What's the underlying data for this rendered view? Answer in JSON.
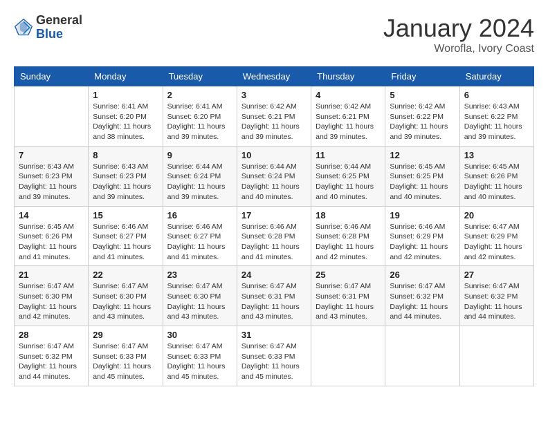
{
  "header": {
    "logo_general": "General",
    "logo_blue": "Blue",
    "month_year": "January 2024",
    "location": "Worofla, Ivory Coast"
  },
  "weekdays": [
    "Sunday",
    "Monday",
    "Tuesday",
    "Wednesday",
    "Thursday",
    "Friday",
    "Saturday"
  ],
  "weeks": [
    [
      {
        "day": "",
        "sunrise": "",
        "sunset": "",
        "daylight": ""
      },
      {
        "day": "1",
        "sunrise": "Sunrise: 6:41 AM",
        "sunset": "Sunset: 6:20 PM",
        "daylight": "Daylight: 11 hours and 38 minutes."
      },
      {
        "day": "2",
        "sunrise": "Sunrise: 6:41 AM",
        "sunset": "Sunset: 6:20 PM",
        "daylight": "Daylight: 11 hours and 39 minutes."
      },
      {
        "day": "3",
        "sunrise": "Sunrise: 6:42 AM",
        "sunset": "Sunset: 6:21 PM",
        "daylight": "Daylight: 11 hours and 39 minutes."
      },
      {
        "day": "4",
        "sunrise": "Sunrise: 6:42 AM",
        "sunset": "Sunset: 6:21 PM",
        "daylight": "Daylight: 11 hours and 39 minutes."
      },
      {
        "day": "5",
        "sunrise": "Sunrise: 6:42 AM",
        "sunset": "Sunset: 6:22 PM",
        "daylight": "Daylight: 11 hours and 39 minutes."
      },
      {
        "day": "6",
        "sunrise": "Sunrise: 6:43 AM",
        "sunset": "Sunset: 6:22 PM",
        "daylight": "Daylight: 11 hours and 39 minutes."
      }
    ],
    [
      {
        "day": "7",
        "sunrise": "Sunrise: 6:43 AM",
        "sunset": "Sunset: 6:23 PM",
        "daylight": "Daylight: 11 hours and 39 minutes."
      },
      {
        "day": "8",
        "sunrise": "Sunrise: 6:43 AM",
        "sunset": "Sunset: 6:23 PM",
        "daylight": "Daylight: 11 hours and 39 minutes."
      },
      {
        "day": "9",
        "sunrise": "Sunrise: 6:44 AM",
        "sunset": "Sunset: 6:24 PM",
        "daylight": "Daylight: 11 hours and 39 minutes."
      },
      {
        "day": "10",
        "sunrise": "Sunrise: 6:44 AM",
        "sunset": "Sunset: 6:24 PM",
        "daylight": "Daylight: 11 hours and 40 minutes."
      },
      {
        "day": "11",
        "sunrise": "Sunrise: 6:44 AM",
        "sunset": "Sunset: 6:25 PM",
        "daylight": "Daylight: 11 hours and 40 minutes."
      },
      {
        "day": "12",
        "sunrise": "Sunrise: 6:45 AM",
        "sunset": "Sunset: 6:25 PM",
        "daylight": "Daylight: 11 hours and 40 minutes."
      },
      {
        "day": "13",
        "sunrise": "Sunrise: 6:45 AM",
        "sunset": "Sunset: 6:26 PM",
        "daylight": "Daylight: 11 hours and 40 minutes."
      }
    ],
    [
      {
        "day": "14",
        "sunrise": "Sunrise: 6:45 AM",
        "sunset": "Sunset: 6:26 PM",
        "daylight": "Daylight: 11 hours and 41 minutes."
      },
      {
        "day": "15",
        "sunrise": "Sunrise: 6:46 AM",
        "sunset": "Sunset: 6:27 PM",
        "daylight": "Daylight: 11 hours and 41 minutes."
      },
      {
        "day": "16",
        "sunrise": "Sunrise: 6:46 AM",
        "sunset": "Sunset: 6:27 PM",
        "daylight": "Daylight: 11 hours and 41 minutes."
      },
      {
        "day": "17",
        "sunrise": "Sunrise: 6:46 AM",
        "sunset": "Sunset: 6:28 PM",
        "daylight": "Daylight: 11 hours and 41 minutes."
      },
      {
        "day": "18",
        "sunrise": "Sunrise: 6:46 AM",
        "sunset": "Sunset: 6:28 PM",
        "daylight": "Daylight: 11 hours and 42 minutes."
      },
      {
        "day": "19",
        "sunrise": "Sunrise: 6:46 AM",
        "sunset": "Sunset: 6:29 PM",
        "daylight": "Daylight: 11 hours and 42 minutes."
      },
      {
        "day": "20",
        "sunrise": "Sunrise: 6:47 AM",
        "sunset": "Sunset: 6:29 PM",
        "daylight": "Daylight: 11 hours and 42 minutes."
      }
    ],
    [
      {
        "day": "21",
        "sunrise": "Sunrise: 6:47 AM",
        "sunset": "Sunset: 6:30 PM",
        "daylight": "Daylight: 11 hours and 42 minutes."
      },
      {
        "day": "22",
        "sunrise": "Sunrise: 6:47 AM",
        "sunset": "Sunset: 6:30 PM",
        "daylight": "Daylight: 11 hours and 43 minutes."
      },
      {
        "day": "23",
        "sunrise": "Sunrise: 6:47 AM",
        "sunset": "Sunset: 6:30 PM",
        "daylight": "Daylight: 11 hours and 43 minutes."
      },
      {
        "day": "24",
        "sunrise": "Sunrise: 6:47 AM",
        "sunset": "Sunset: 6:31 PM",
        "daylight": "Daylight: 11 hours and 43 minutes."
      },
      {
        "day": "25",
        "sunrise": "Sunrise: 6:47 AM",
        "sunset": "Sunset: 6:31 PM",
        "daylight": "Daylight: 11 hours and 43 minutes."
      },
      {
        "day": "26",
        "sunrise": "Sunrise: 6:47 AM",
        "sunset": "Sunset: 6:32 PM",
        "daylight": "Daylight: 11 hours and 44 minutes."
      },
      {
        "day": "27",
        "sunrise": "Sunrise: 6:47 AM",
        "sunset": "Sunset: 6:32 PM",
        "daylight": "Daylight: 11 hours and 44 minutes."
      }
    ],
    [
      {
        "day": "28",
        "sunrise": "Sunrise: 6:47 AM",
        "sunset": "Sunset: 6:32 PM",
        "daylight": "Daylight: 11 hours and 44 minutes."
      },
      {
        "day": "29",
        "sunrise": "Sunrise: 6:47 AM",
        "sunset": "Sunset: 6:33 PM",
        "daylight": "Daylight: 11 hours and 45 minutes."
      },
      {
        "day": "30",
        "sunrise": "Sunrise: 6:47 AM",
        "sunset": "Sunset: 6:33 PM",
        "daylight": "Daylight: 11 hours and 45 minutes."
      },
      {
        "day": "31",
        "sunrise": "Sunrise: 6:47 AM",
        "sunset": "Sunset: 6:33 PM",
        "daylight": "Daylight: 11 hours and 45 minutes."
      },
      {
        "day": "",
        "sunrise": "",
        "sunset": "",
        "daylight": ""
      },
      {
        "day": "",
        "sunrise": "",
        "sunset": "",
        "daylight": ""
      },
      {
        "day": "",
        "sunrise": "",
        "sunset": "",
        "daylight": ""
      }
    ]
  ]
}
